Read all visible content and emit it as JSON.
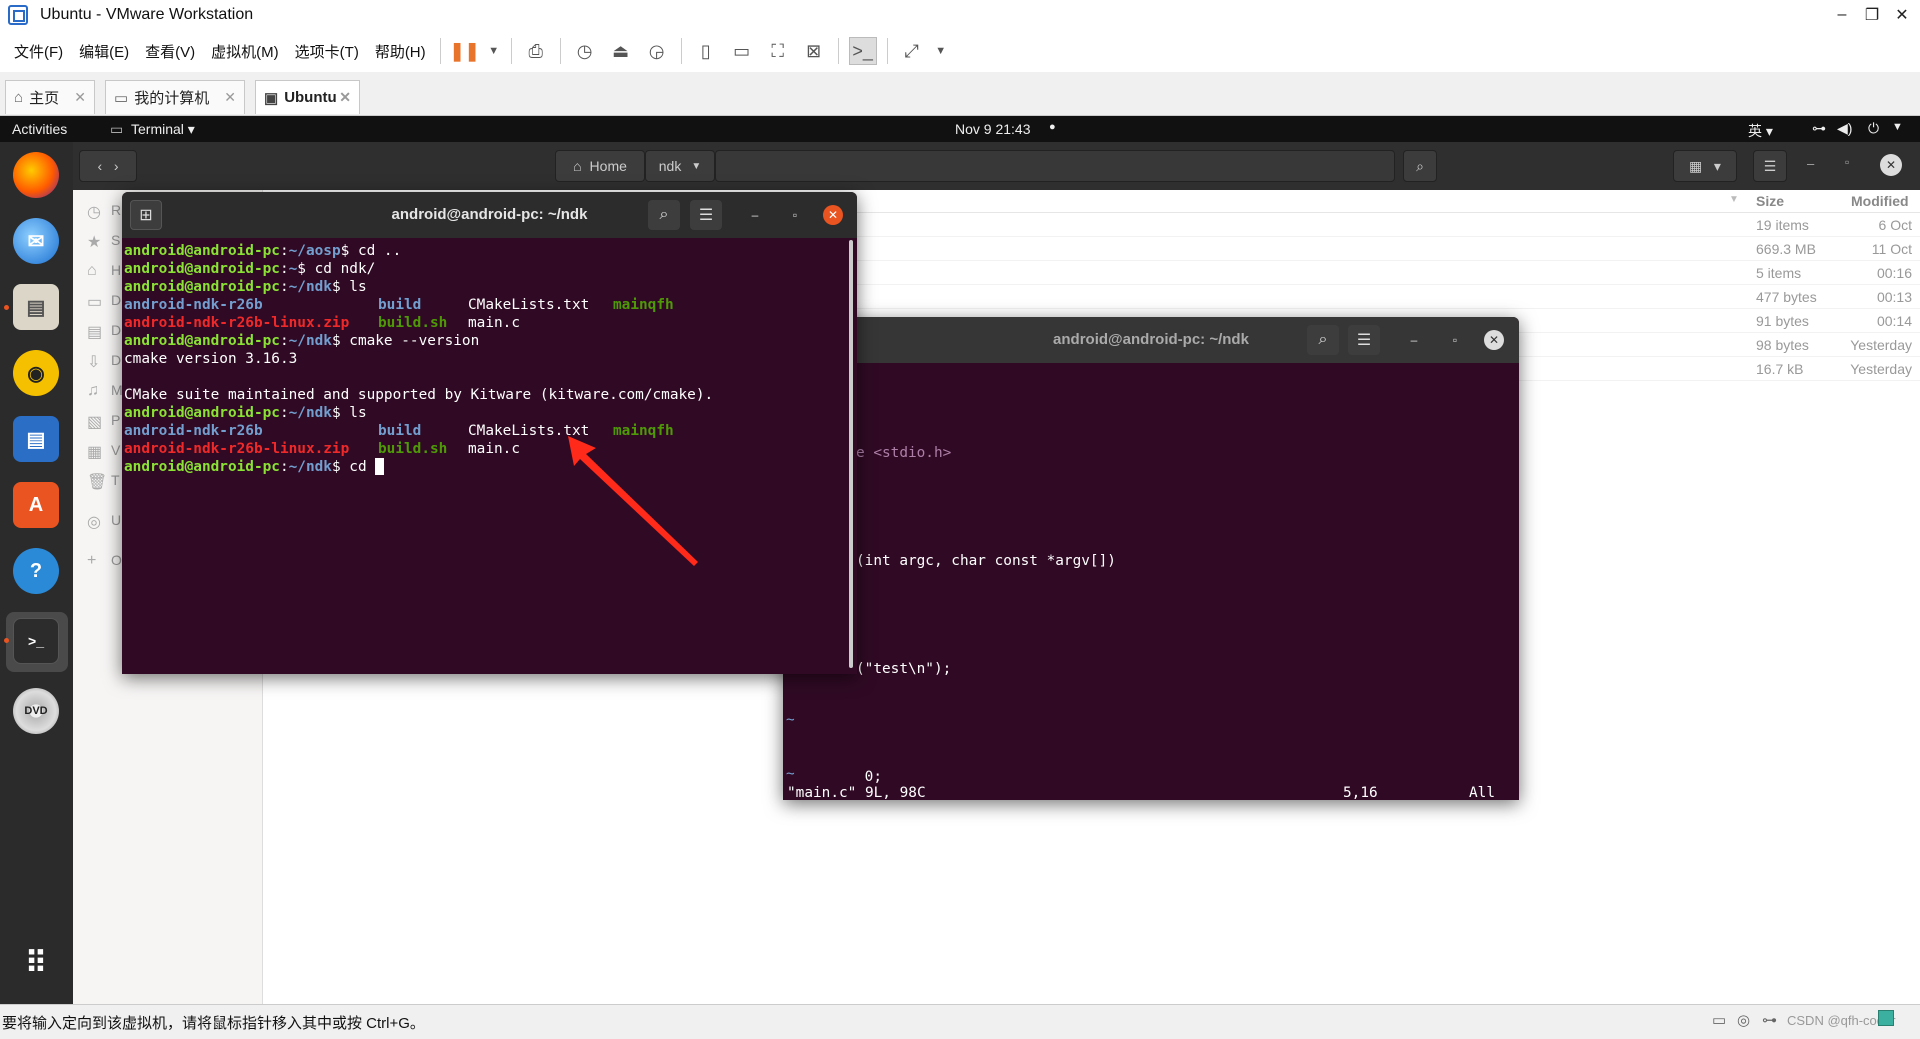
{
  "window": {
    "title": "Ubuntu - VMware Workstation",
    "controls": [
      "–",
      "❐",
      "✕"
    ]
  },
  "menu": [
    "文件(F)",
    "编辑(E)",
    "查看(V)",
    "虚拟机(M)",
    "选项卡(T)",
    "帮助(H)"
  ],
  "tabs": [
    {
      "label": "主页"
    },
    {
      "label": "我的计算机"
    },
    {
      "label": "Ubuntu"
    }
  ],
  "guest": {
    "topbar": {
      "activities": "Activities",
      "app": "Terminal ▾",
      "clock": "Nov 9  21:43",
      "ime": "英 ▾"
    },
    "files": {
      "path": [
        "Home",
        "ndk"
      ],
      "columns": {
        "size": "Size",
        "modified": "Modified"
      },
      "rows": [
        {
          "size": "19 items",
          "modified": "6 Oct"
        },
        {
          "size": "669.3 MB",
          "modified": "11 Oct"
        },
        {
          "size": "5 items",
          "modified": "00:16"
        },
        {
          "size": "477 bytes",
          "modified": "00:13"
        },
        {
          "size": "91 bytes",
          "modified": "00:14"
        },
        {
          "size": "98 bytes",
          "modified": "Yesterday"
        },
        {
          "size": "16.7 kB",
          "modified": "Yesterday"
        }
      ],
      "sidebar_letters": [
        "R",
        "S",
        "H",
        "D",
        "D",
        "D",
        "M",
        "P",
        "V",
        "T",
        "U",
        "O"
      ]
    },
    "terminal1": {
      "title": "android@android-pc: ~/ndk",
      "user": "android@android-pc",
      "lines": [
        {
          "path": "~/aosp",
          "cmd": "cd .."
        },
        {
          "path": "~",
          "cmd": "cd ndk/"
        },
        {
          "path": "~/ndk",
          "cmd": "ls"
        }
      ],
      "ls": {
        "d1": "android-ndk-r26b",
        "d2": "build",
        "f1": "CMakeLists.txt",
        "x1": "mainqfh",
        "z1": "android-ndk-r26b-linux.zip",
        "x2": "build.sh",
        "f2": "main.c"
      },
      "cmake_cmd": "cmake --version",
      "cmake_out1": "cmake version 3.16.3",
      "cmake_out2": "CMake suite maintained and supported by Kitware (kitware.com/cmake).",
      "ls_cmd": "ls",
      "last_cmd": "cd "
    },
    "terminal2": {
      "title": "android@android-pc: ~/ndk",
      "code": [
        "e <stdio.h>",
        "",
        "(int argc, char const *argv[])",
        "",
        "(\"test\\n\");",
        "",
        " 0;"
      ],
      "tildes": [
        "~",
        "~",
        "~",
        "~",
        "~",
        "~"
      ],
      "status_file": "\"main.c\" 9L, 98C",
      "status_pos": "5,16",
      "status_all": "All"
    }
  },
  "statusbar": {
    "hint": "要将输入定向到该虚拟机，请将鼠标指针移入其中或按 Ctrl+G。",
    "watermark": "CSDN @qfh-coder"
  },
  "colors": {
    "terminal_bg": "#300a24",
    "ubuntu_orange": "#e95420",
    "prompt_green": "#8ae234",
    "path_blue": "#729fcf",
    "archive_red": "#ef2929"
  }
}
